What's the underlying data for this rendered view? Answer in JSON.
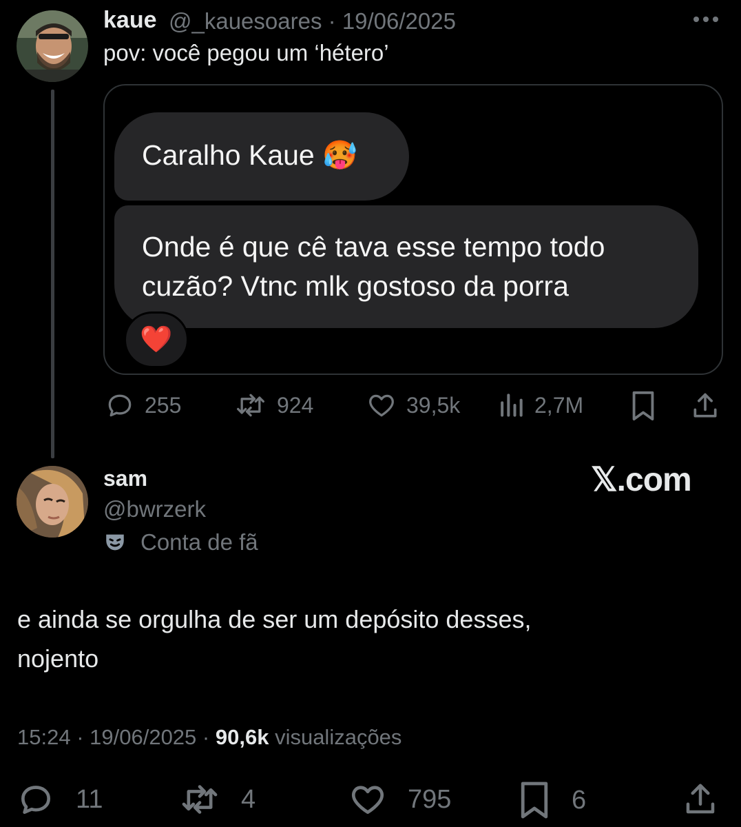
{
  "parent": {
    "name": "kaue",
    "handle": "@_kauesoares",
    "date": "19/06/2025",
    "text": "pov: você pegou um ‘hétero’",
    "card": {
      "bubble1": "Caralho Kaue 🥵",
      "bubble2_line1": "Onde é que cê tava esse tempo todo",
      "bubble2_line2": "cuzão? Vtnc mlk gostoso da porra",
      "reaction": "❤️"
    },
    "stats": {
      "replies": "255",
      "reposts": "924",
      "likes": "39,5k",
      "views": "2,7M"
    }
  },
  "reply": {
    "name": "sam",
    "handle": "@bwrzerk",
    "badge_label": "Conta de fã",
    "badge_icon": "masks-icon",
    "watermark": "𝕏.com",
    "text_line1": "e ainda se orgulha de ser um depósito desses,",
    "text_line2": "nojento",
    "time": "15:24",
    "date": "19/06/2025",
    "views_count": "90,6k",
    "views_label": "visualizações",
    "stats": {
      "replies": "11",
      "reposts": "4",
      "likes": "795",
      "bookmarks": "6"
    }
  },
  "colors": {
    "background": "#000000",
    "text": "#e7e9ea",
    "muted": "#71767b",
    "bubble": "#262628",
    "border": "#2f3336"
  }
}
